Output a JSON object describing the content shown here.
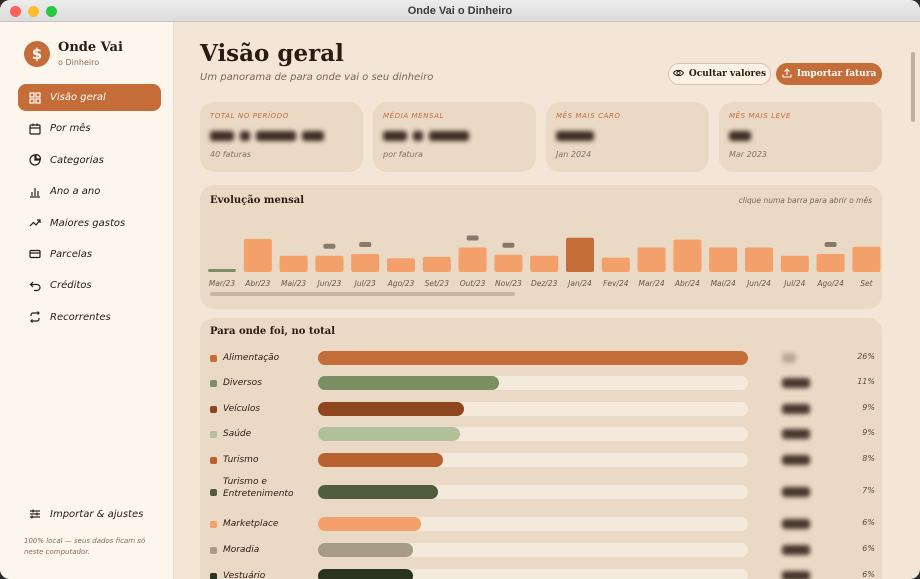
{
  "window": {
    "title": "Onde Vai o Dinheiro"
  },
  "brand": {
    "logo_glyph": "$",
    "title": "Onde Vai",
    "subtitle": "o Dinheiro"
  },
  "nav": [
    {
      "label": "Visão geral",
      "icon": "grid-icon",
      "active": true
    },
    {
      "label": "Por mês",
      "icon": "calendar-icon",
      "active": false
    },
    {
      "label": "Categorias",
      "icon": "pie-chart-icon",
      "active": false
    },
    {
      "label": "Ano a ano",
      "icon": "bar-chart-icon",
      "active": false
    },
    {
      "label": "Maiores gastos",
      "icon": "trending-up-icon",
      "active": false
    },
    {
      "label": "Parcelas",
      "icon": "credit-card-icon",
      "active": false
    },
    {
      "label": "Créditos",
      "icon": "return-arrow-icon",
      "active": false
    },
    {
      "label": "Recorrentes",
      "icon": "repeat-icon",
      "active": false
    }
  ],
  "settings": {
    "label": "Importar & ajustes",
    "icon": "sliders-icon"
  },
  "sidebar_footer": "100% local — seus dados ficam só neste computador.",
  "header": {
    "title": "Visão geral",
    "subtitle": "Um panorama de para onde vai o seu dinheiro",
    "hide_values_label": "Ocultar valores",
    "import_label": "Importar fatura"
  },
  "stats": [
    {
      "label": "TOTAL NO PERÍODO",
      "hint": "40 faturas"
    },
    {
      "label": "MÉDIA MENSAL",
      "hint": "por fatura"
    },
    {
      "label": "MÊS MAIS CARO",
      "hint": "Jan 2024"
    },
    {
      "label": "MÊS MAIS LEVE",
      "hint": "Mar 2023"
    }
  ],
  "evolution": {
    "title": "Evolução mensal",
    "hint": "clique numa barra para abrir o mês",
    "months": [
      "Mar/23",
      "Abr/23",
      "Mai/23",
      "Jun/23",
      "Jul/23",
      "Ago/23",
      "Set/23",
      "Out/23",
      "Nov/23",
      "Dez/23",
      "Jan/24",
      "Fev/24",
      "Mar/24",
      "Abr/24",
      "Mai/24",
      "Jun/24",
      "Jul/24",
      "Ago/24",
      "Set"
    ],
    "relative_levels": [
      0.08,
      0.92,
      0.45,
      0.45,
      0.5,
      0.38,
      0.42,
      0.68,
      0.48,
      0.45,
      0.95,
      0.4,
      0.68,
      0.9,
      0.68,
      0.68,
      0.45,
      0.5,
      0.7
    ],
    "highlight_index": 10,
    "colors": {
      "bar": "#f4a06a",
      "highlight": "#c46d38",
      "lowest": "#7c8f63"
    }
  },
  "totals": {
    "title": "Para onde foi, no total",
    "categories": [
      {
        "name": "Alimentação",
        "pct_label": "26%",
        "share": 1.0,
        "color": "#c46d38"
      },
      {
        "name": "Diversos",
        "pct_label": "11%",
        "share": 0.42,
        "color": "#7c8f63"
      },
      {
        "name": "Veículos",
        "pct_label": "9%",
        "share": 0.34,
        "color": "#8d461d"
      },
      {
        "name": "Saúde",
        "pct_label": "9%",
        "share": 0.33,
        "color": "#b1c29a"
      },
      {
        "name": "Turismo",
        "pct_label": "8%",
        "share": 0.29,
        "color": "#b8632f"
      },
      {
        "name": "Turismo e Entretenimento",
        "pct_label": "7%",
        "share": 0.28,
        "color": "#4e5e3a"
      },
      {
        "name": "Marketplace",
        "pct_label": "6%",
        "share": 0.24,
        "color": "#f4a06a"
      },
      {
        "name": "Moradia",
        "pct_label": "6%",
        "share": 0.22,
        "color": "#a89c88"
      },
      {
        "name": "Vestuário",
        "pct_label": "6%",
        "share": 0.22,
        "color": "#2a3320"
      }
    ]
  }
}
